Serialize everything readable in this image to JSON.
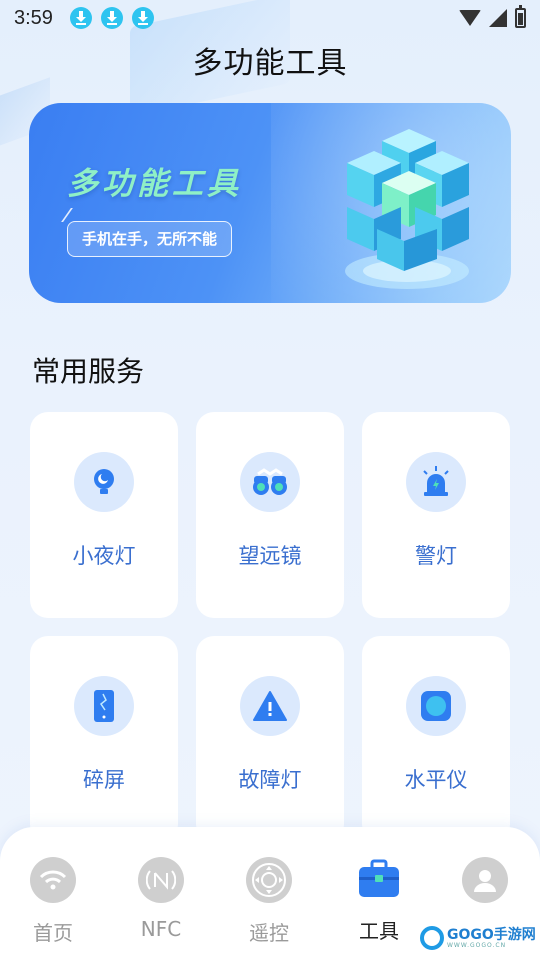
{
  "status_bar": {
    "time": "3:59",
    "download_icons": [
      "download-icon",
      "download-icon",
      "download-icon"
    ],
    "right_icons": [
      "wifi-icon",
      "signal-icon",
      "battery-charging-icon"
    ]
  },
  "header": {
    "title": "多功能工具"
  },
  "banner": {
    "title": "多功能工具",
    "tagline": "手机在手，无所不能",
    "art_icon": "cube-stack-icon"
  },
  "section": {
    "title": "常用服务"
  },
  "tools": [
    {
      "label": "小夜灯",
      "icon": "night-light-icon"
    },
    {
      "label": "望远镜",
      "icon": "binoculars-icon"
    },
    {
      "label": "警灯",
      "icon": "siren-icon"
    },
    {
      "label": "碎屏",
      "icon": "cracked-phone-icon"
    },
    {
      "label": "故障灯",
      "icon": "warning-triangle-icon"
    },
    {
      "label": "水平仪",
      "icon": "level-icon"
    }
  ],
  "bottom_nav": [
    {
      "label": "首页",
      "icon": "wifi-home-icon",
      "active": false
    },
    {
      "label": "NFC",
      "icon": "nfc-icon",
      "active": false
    },
    {
      "label": "遥控",
      "icon": "remote-dpad-icon",
      "active": false
    },
    {
      "label": "工具",
      "icon": "toolbox-icon",
      "active": true
    },
    {
      "label": "",
      "icon": "user-icon",
      "active": false
    }
  ],
  "watermark": {
    "text": "GOGO手游网",
    "sub": "WWW.GOGO.CN"
  },
  "colors": {
    "accent": "#3a7ef2",
    "tool_label": "#3a6fcf",
    "icon_bg": "#dbe9fd",
    "banner_title": "#8ff0c6"
  }
}
